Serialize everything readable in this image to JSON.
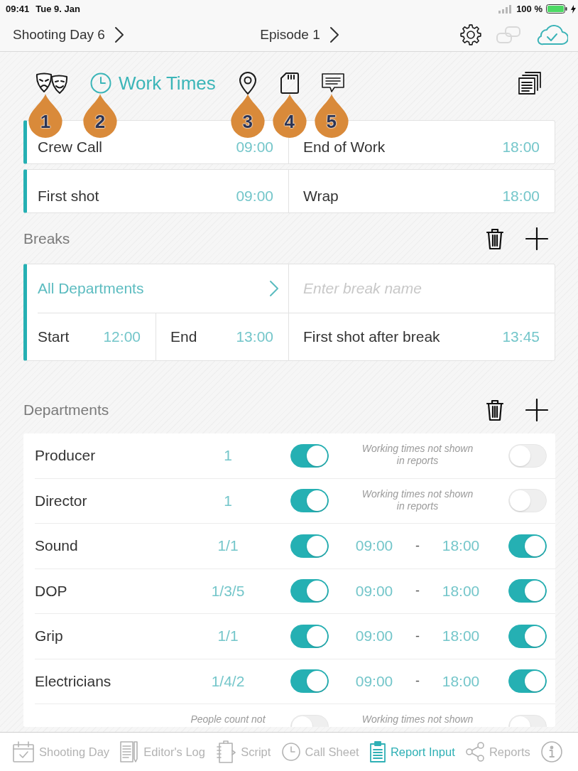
{
  "status_bar": {
    "time": "09:41",
    "date": "Tue 9. Jan",
    "battery": "100 %"
  },
  "nav_bar": {
    "breadcrumbs": [
      {
        "label": "Shooting Day 6"
      },
      {
        "label": "Episode 1"
      }
    ],
    "actions": [
      {
        "kind": "settings",
        "disabled": false
      },
      {
        "kind": "link",
        "disabled": true
      },
      {
        "kind": "cloud-sync",
        "disabled": false
      }
    ]
  },
  "section_tabs": [
    {
      "kind": "masks",
      "selected": false,
      "callout": "1"
    },
    {
      "kind": "clock",
      "label": "Work Times",
      "selected": true,
      "callout": "2"
    },
    {
      "kind": "pin",
      "selected": false,
      "callout": "3"
    },
    {
      "kind": "sd-card",
      "selected": false,
      "callout": "4"
    },
    {
      "kind": "message",
      "selected": false,
      "callout": "5"
    }
  ],
  "work_times": [
    [
      {
        "label": "Crew Call",
        "value": "09:00"
      },
      {
        "label": "End of Work",
        "value": "18:00"
      }
    ],
    [
      {
        "label": "First shot",
        "value": "09:00"
      },
      {
        "label": "Wrap",
        "value": "18:00"
      }
    ]
  ],
  "breaks": {
    "title": "Breaks",
    "items": [
      {
        "department": "All Departments",
        "name_field": {
          "placeholder": "Enter break name"
        },
        "start_label": "Start",
        "start": "12:00",
        "end_label": "End",
        "end": "13:00",
        "first_shot_label": "First shot after break",
        "first_shot": "13:45"
      }
    ]
  },
  "departments": {
    "title": "Departments",
    "rows": [
      {
        "kind": "note",
        "name": "Producer",
        "count": "1",
        "enabled": true,
        "note": "Working times not shown in reports",
        "times_on": false
      },
      {
        "kind": "note",
        "name": "Director",
        "count": "1",
        "enabled": true,
        "note": "Working times not shown in reports",
        "times_on": false
      },
      {
        "kind": "times",
        "name": "Sound",
        "count": "1/1",
        "enabled": true,
        "start": "09:00",
        "separator": "-",
        "end": "18:00",
        "times_on": true
      },
      {
        "kind": "times",
        "name": "DOP",
        "count": "1/3/5",
        "enabled": true,
        "start": "09:00",
        "separator": "-",
        "end": "18:00",
        "times_on": true
      },
      {
        "kind": "times",
        "name": "Grip",
        "count": "1/1",
        "enabled": true,
        "start": "09:00",
        "separator": "-",
        "end": "18:00",
        "times_on": true
      },
      {
        "kind": "times",
        "name": "Electricians",
        "count": "1/4/2",
        "enabled": true,
        "start": "09:00",
        "separator": "-",
        "end": "18:00",
        "times_on": true
      },
      {
        "kind": "note",
        "count_note": "People count not",
        "enabled": false,
        "note": "Working times not shown",
        "times_on": false
      }
    ]
  },
  "tab_bar": [
    {
      "kind": "calendar",
      "label": "Shooting Day",
      "selected": false
    },
    {
      "kind": "log",
      "label": "Editor's Log",
      "selected": false
    },
    {
      "kind": "script",
      "label": "Script",
      "selected": false
    },
    {
      "kind": "clock",
      "label": "Call Sheet",
      "selected": false
    },
    {
      "kind": "clipboard",
      "label": "Report Input",
      "selected": true
    },
    {
      "kind": "share",
      "label": "Reports",
      "selected": false
    },
    {
      "kind": "info",
      "selected": false
    }
  ]
}
